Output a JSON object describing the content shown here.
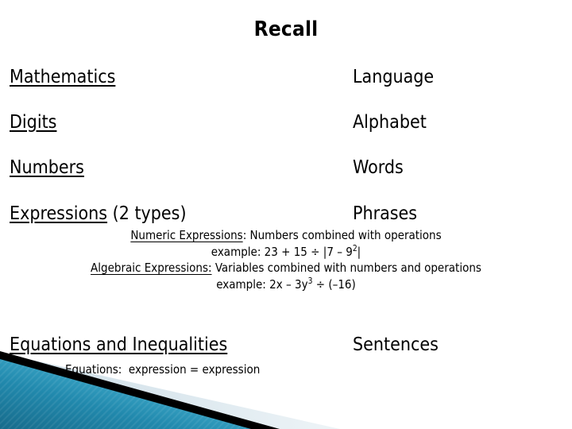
{
  "slide": {
    "title": "Recall",
    "rows": [
      {
        "left_main": "Mathematics",
        "left_suffix": "",
        "right": "Language"
      },
      {
        "left_main": "Digits",
        "left_suffix": "",
        "right": "Alphabet"
      },
      {
        "left_main": "Numbers",
        "left_suffix": "",
        "right": "Words"
      },
      {
        "left_main": "Expressions",
        "left_suffix": " (2 types)",
        "right": "Phrases"
      },
      {
        "left_main": "Equations and Inequalities",
        "left_suffix": "",
        "right": "Sentences"
      }
    ],
    "detail": {
      "numeric_label": "Numeric Expressions",
      "numeric_text": ": Numbers combined with operations",
      "numeric_example": "example: 23 + 15 ÷ |7 – 9",
      "numeric_example_exp": "2",
      "numeric_example_tail": "|",
      "algebraic_label": "Algebraic Expressions:",
      "algebraic_text": " Variables combined with numbers and operations",
      "algebraic_example": "example: 2x – 3y",
      "algebraic_example_exp": "3",
      "algebraic_example_tail": " ÷ (–16)"
    },
    "equations_subline": "Equations:  expression = expression"
  },
  "colors": {
    "text": "#000000",
    "background": "#ffffff",
    "decor_teal_dark": "#1b7696",
    "decor_teal_light": "#57bcd9",
    "decor_black": "#000000",
    "decor_pale": "#dde9ef"
  }
}
